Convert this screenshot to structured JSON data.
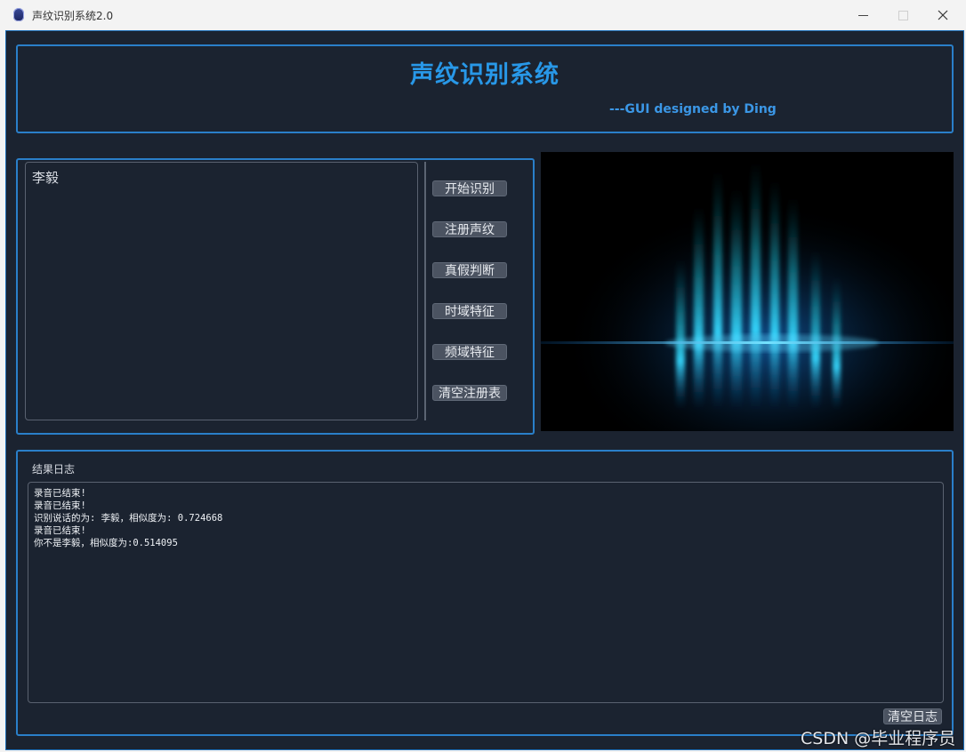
{
  "window": {
    "title": "声纹识别系统2.0",
    "icon": "app-icon",
    "controls": {
      "minimize": "minimize-icon",
      "maximize": "maximize-icon",
      "close": "close-icon"
    }
  },
  "header": {
    "title": "声纹识别系统",
    "subtitle": "---GUI designed by Ding"
  },
  "registry": {
    "names": [
      "李毅"
    ]
  },
  "buttons": {
    "start": "开始识别",
    "register": "注册声纹",
    "authenticity": "真假判断",
    "time_domain": "时域特征",
    "freq_domain": "频域特征",
    "clear_registry": "清空注册表"
  },
  "log": {
    "label": "结果日志",
    "lines": [
      "录音已结束!",
      "录音已结束!",
      "识别说话的为: 李毅，相似度为: 0.724668",
      "录音已结束!",
      "你不是李毅，相似度为:0.514095"
    ],
    "clear_label": "清空日志"
  },
  "watermark": "CSDN @毕业程序员",
  "colors": {
    "background": "#1b2330",
    "accent": "#2898e8",
    "border": "#2a7fc9",
    "button": "#4b5361"
  }
}
